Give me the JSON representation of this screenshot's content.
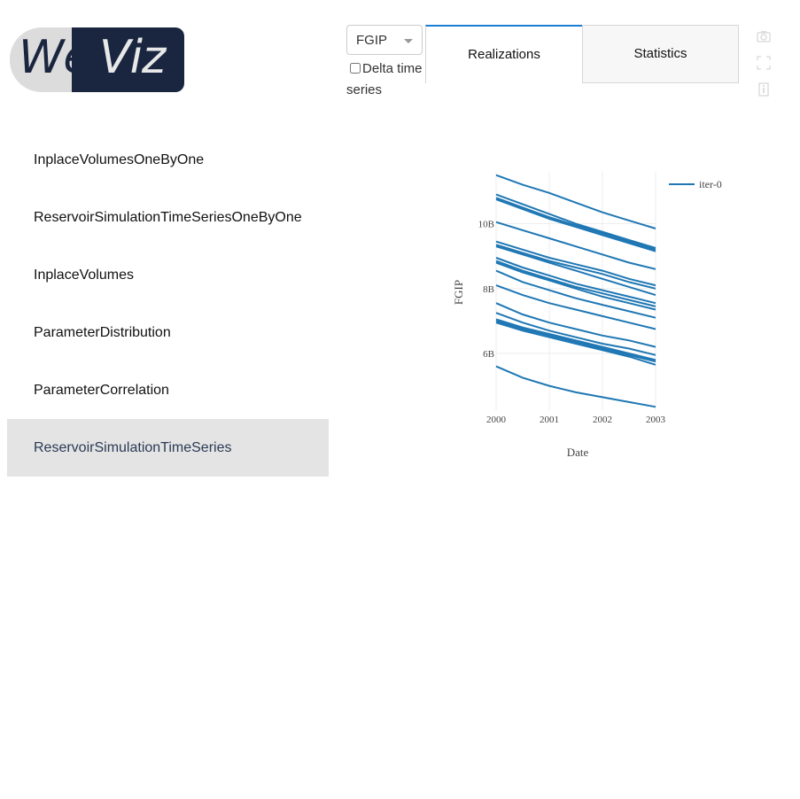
{
  "logo": {
    "text_part1": "Web",
    "text_part2": "Viz"
  },
  "sidebar": {
    "items": [
      {
        "label": "InplaceVolumesOneByOne",
        "active": false
      },
      {
        "label": "ReservoirSimulationTimeSeriesOneByOne",
        "active": false
      },
      {
        "label": "InplaceVolumes",
        "active": false
      },
      {
        "label": "ParameterDistribution",
        "active": false
      },
      {
        "label": "ParameterCorrelation",
        "active": false
      },
      {
        "label": "ReservoirSimulationTimeSeries",
        "active": true
      }
    ]
  },
  "controls": {
    "vector_dropdown": {
      "selected": "FGIP"
    },
    "delta_checkbox": {
      "label": "Delta time series",
      "checked": false
    }
  },
  "tabs": [
    {
      "label": "Realizations",
      "active": true
    },
    {
      "label": "Statistics",
      "active": false
    }
  ],
  "modebar": {
    "icons": [
      "camera-icon",
      "fullscreen-icon",
      "info-icon"
    ]
  },
  "colors": {
    "series": "#1f77b4",
    "active_tab_border": "#1a7ed4",
    "active_nav_bg": "#e4e4e4",
    "logo_dark": "#1a2640"
  },
  "chart_data": {
    "type": "line",
    "title": "",
    "xlabel": "Date",
    "ylabel": "FGIP",
    "x": [
      2000.0,
      2000.5,
      2001.0,
      2001.5,
      2002.0,
      2002.5,
      2003.0
    ],
    "xticks": [
      "2000",
      "2001",
      "2002",
      "2003"
    ],
    "yticks": [
      "6B",
      "8B",
      "10B"
    ],
    "ylim": [
      4.25,
      11.6
    ],
    "grid": true,
    "legend_position": "top-right",
    "series": [
      {
        "name": "iter-0",
        "realizations": [
          [
            11.5,
            11.2,
            10.95,
            10.65,
            10.35,
            10.1,
            9.85
          ],
          [
            10.9,
            10.6,
            10.3,
            10.0,
            9.75,
            9.5,
            9.25
          ],
          [
            10.8,
            10.5,
            10.2,
            9.95,
            9.7,
            9.45,
            9.2
          ],
          [
            10.75,
            10.45,
            10.15,
            9.9,
            9.65,
            9.4,
            9.15
          ],
          [
            10.05,
            9.8,
            9.55,
            9.3,
            9.05,
            8.8,
            8.6
          ],
          [
            9.45,
            9.2,
            8.95,
            8.75,
            8.55,
            8.3,
            8.1
          ],
          [
            9.35,
            9.1,
            8.85,
            8.65,
            8.45,
            8.2,
            8.0
          ],
          [
            9.3,
            9.05,
            8.8,
            8.55,
            8.3,
            8.05,
            7.8
          ],
          [
            8.95,
            8.65,
            8.4,
            8.15,
            7.95,
            7.75,
            7.55
          ],
          [
            8.85,
            8.55,
            8.3,
            8.05,
            7.85,
            7.65,
            7.45
          ],
          [
            8.8,
            8.5,
            8.25,
            8.0,
            7.75,
            7.55,
            7.35
          ],
          [
            8.55,
            8.2,
            7.95,
            7.7,
            7.5,
            7.3,
            7.1
          ],
          [
            8.1,
            7.8,
            7.55,
            7.35,
            7.15,
            6.95,
            6.75
          ],
          [
            7.55,
            7.2,
            6.95,
            6.75,
            6.55,
            6.4,
            6.2
          ],
          [
            7.25,
            6.95,
            6.7,
            6.5,
            6.3,
            6.15,
            5.95
          ],
          [
            7.05,
            6.8,
            6.6,
            6.4,
            6.2,
            6.0,
            5.8
          ],
          [
            7.0,
            6.75,
            6.55,
            6.35,
            6.15,
            5.95,
            5.75
          ],
          [
            6.95,
            6.7,
            6.5,
            6.3,
            6.1,
            5.9,
            5.65
          ],
          [
            5.6,
            5.25,
            5.0,
            4.8,
            4.65,
            4.5,
            4.35
          ]
        ]
      }
    ]
  }
}
